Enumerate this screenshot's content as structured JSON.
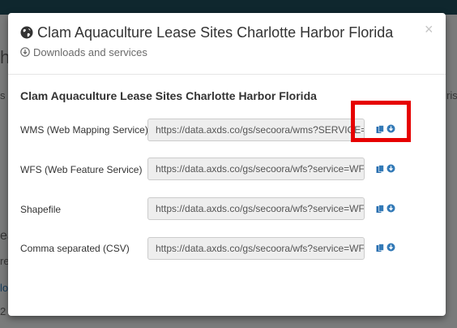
{
  "background": {
    "fragment_left_1": "he",
    "fragment_left_2": "s",
    "fragment_left_3": "ea",
    "fragment_left_4": "re",
    "fragment_left_5": "lo",
    "fragment_left_6": "2",
    "fragment_right_1": "ris"
  },
  "modal": {
    "title": "Clam Aquaculture Lease Sites Charlotte Harbor Florida",
    "subtitle": "Downloads and services",
    "close_label": "×",
    "section_title": "Clam Aquaculture Lease Sites Charlotte Harbor Florida",
    "services": [
      {
        "label": "WMS (Web Mapping Service)",
        "url": "https://data.axds.co/gs/secoora/wms?SERVICE=WMS&REQUEST=GetCapabilities"
      },
      {
        "label": "WFS (Web Feature Service)",
        "url": "https://data.axds.co/gs/secoora/wfs?service=WFS&request=GetCapabilities"
      },
      {
        "label": "Shapefile",
        "url": "https://data.axds.co/gs/secoora/wfs?service=WFS&outputFormat=shape-zip"
      },
      {
        "label": "Comma separated (CSV)",
        "url": "https://data.axds.co/gs/secoora/wfs?service=WFS&outputFormat=csv"
      }
    ]
  },
  "colors": {
    "accent": "#337ab7",
    "highlight": "#e60000",
    "topbar": "#1e4e5c"
  },
  "icons": {
    "header": "globe-icon",
    "subtitle": "download-circle-icon",
    "row_copy": "copy-clipboard-icon",
    "row_download": "download-circle-icon"
  }
}
